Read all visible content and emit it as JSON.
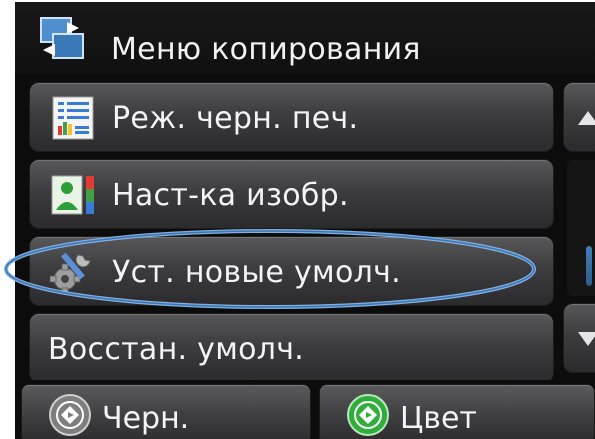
{
  "header": {
    "title": "Меню копирования",
    "icon": "copy-icon"
  },
  "menu": {
    "items": [
      {
        "label": "Реж. черн. печ.",
        "icon": "document-list-icon"
      },
      {
        "label": "Наст-ка изобр.",
        "icon": "image-adjust-icon"
      },
      {
        "label": "Уст. новые умолч.",
        "icon": "tools-gear-icon",
        "highlighted": true
      },
      {
        "label": "Восстан. умолч.",
        "icon": ""
      }
    ]
  },
  "scroll": {
    "up_icon": "triangle-up-icon",
    "down_icon": "triangle-down-icon",
    "position": 0.65
  },
  "bottom": {
    "black_label": "Черн.",
    "color_label": "Цвет"
  },
  "colors": {
    "callout": "#4a82c0",
    "start_green": "#2fae3a",
    "start_gray": "#8a8a8a",
    "scroll_thumb": "#3f7fb6"
  }
}
